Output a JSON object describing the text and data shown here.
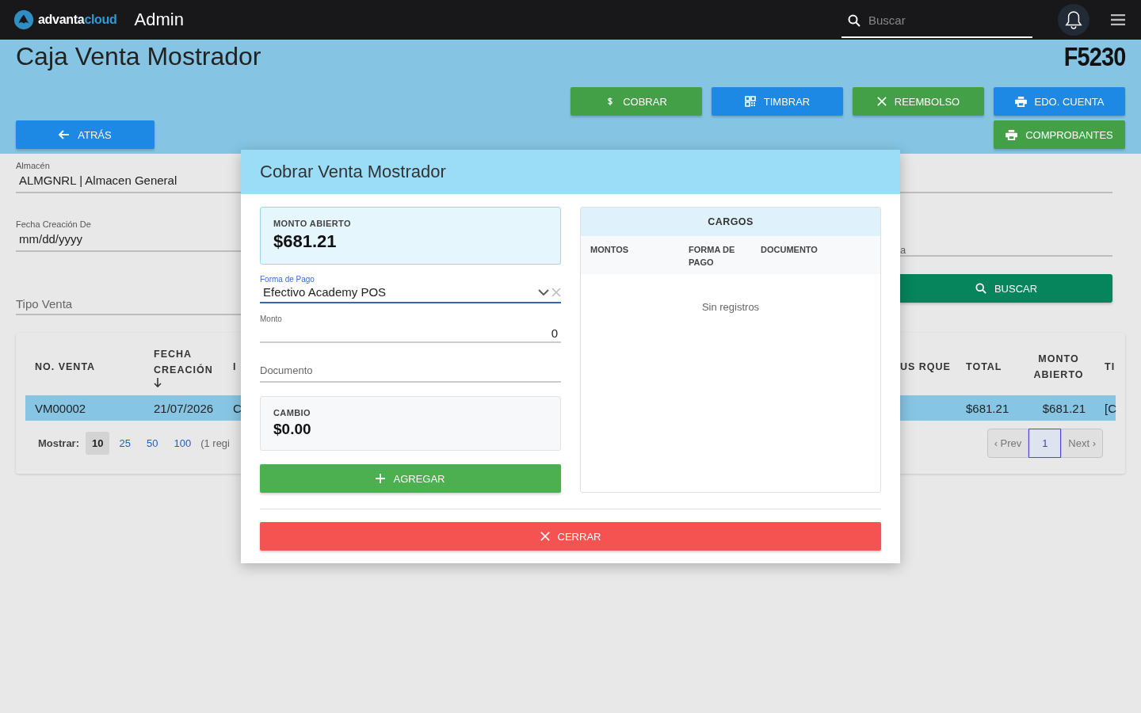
{
  "topbar": {
    "brand": "advanta",
    "brand_accent": "cloud",
    "app_title": "Admin",
    "search": {
      "placeholder": "Buscar"
    }
  },
  "page": {
    "title": "Caja Venta Mostrador",
    "code": "F5230"
  },
  "action_rows": [
    [
      {
        "label": "COBRAR",
        "kind": "dollar",
        "color": "#43a047"
      },
      {
        "label": "TIMBRAR",
        "kind": "qr",
        "color": "#1e88e5"
      },
      {
        "label": "REEMBOLSO",
        "kind": "x",
        "color": "#43a047"
      },
      {
        "label": "EDO. CUENTA",
        "kind": "printer",
        "color": "#1e88e5"
      }
    ],
    [
      {
        "label": "COMPROBANTES",
        "kind": "printer",
        "color": "#43a047"
      }
    ]
  ],
  "back_button": {
    "label": "ATRÁS"
  },
  "filters_left": [
    {
      "kind": "value",
      "label": "Almacén",
      "value": "ALMGNRL | Almacen General"
    },
    {
      "kind": "value",
      "label": "Fecha Creación De",
      "value": "mm/dd/yyyy"
    },
    {
      "kind": "placeholder",
      "placeholder": "Tipo Venta"
    }
  ],
  "filters_right": [
    {
      "kind": "blank"
    },
    {
      "kind": "placeholder",
      "placeholder": "a"
    }
  ],
  "search_button": {
    "label": "BUSCAR"
  },
  "table": {
    "columns_left": [
      {
        "label": "NO. VENTA",
        "sorted": false
      },
      {
        "label": "FECHA CREACIÓN",
        "sorted": true
      },
      {
        "label": "I",
        "sorted": false
      }
    ],
    "columns_right": [
      {
        "label": "US RQUE"
      },
      {
        "label": "TOTAL"
      },
      {
        "label": "MONTO ABIERTO"
      },
      {
        "label": "TI"
      }
    ],
    "rows": [
      {
        "selected": true,
        "cells_left": [
          "VM00002",
          "21/07/2026",
          "C"
        ],
        "cells_right": [
          "$681.21",
          "$681.21",
          "[C"
        ]
      }
    ]
  },
  "pagination": {
    "label": "Mostrar:",
    "sizes": [
      {
        "label": "10",
        "selected": true
      },
      {
        "label": "25",
        "selected": false
      },
      {
        "label": "50",
        "selected": false
      },
      {
        "label": "100",
        "selected": false
      }
    ],
    "info": "(1 regi",
    "prev": "‹ Prev",
    "pages": [
      {
        "label": "1",
        "selected": true
      }
    ],
    "next": "Next ›"
  },
  "modal": {
    "title": "Cobrar Venta Mostrador",
    "monto_abierto": {
      "label": "MONTO ABIERTO",
      "value": "$681.21"
    },
    "forma_pago": {
      "label": "Forma de Pago",
      "value": "Efectivo Academy POS"
    },
    "monto": {
      "label": "Monto",
      "value": "0"
    },
    "documento": {
      "placeholder": "Documento"
    },
    "cambio": {
      "label": "CAMBIO",
      "value": "$0.00"
    },
    "add_button": {
      "label": "AGREGAR"
    },
    "cargos": {
      "title": "CARGOS",
      "columns": [
        "MONTOS",
        "FORMA DE PAGO",
        "DOCUMENTO"
      ],
      "empty": "Sin registros"
    },
    "close_button": {
      "label": "CERRAR"
    }
  }
}
